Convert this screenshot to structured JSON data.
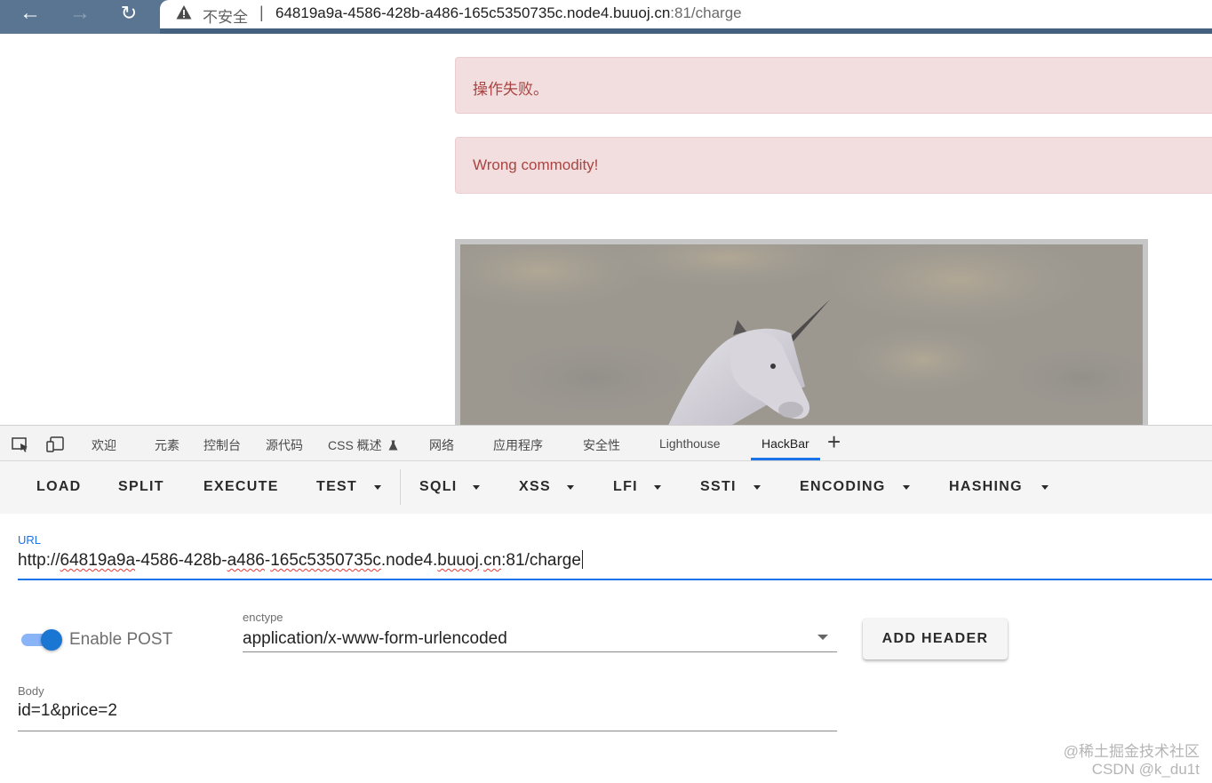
{
  "browser": {
    "nav": {
      "back": "←",
      "forward": "→",
      "reload": "↻"
    },
    "address": {
      "security_label": "不安全",
      "separator": "|",
      "url_host": "64819a9a-4586-428b-a486-165c5350735c.node4.buuoj.cn",
      "url_rest": ":81/charge"
    }
  },
  "page": {
    "alerts": [
      {
        "text": "操作失败。"
      },
      {
        "text": "Wrong commodity!"
      }
    ]
  },
  "devtools": {
    "tabs": [
      {
        "label": "欢迎"
      },
      {
        "label": "元素"
      },
      {
        "label": "控制台"
      },
      {
        "label": "源代码"
      },
      {
        "label": "CSS 概述"
      },
      {
        "label": "网络"
      },
      {
        "label": "应用程序"
      },
      {
        "label": "安全性"
      },
      {
        "label": "Lighthouse"
      },
      {
        "label": "HackBar"
      }
    ],
    "add_tab": "+"
  },
  "hackbar": {
    "toolbar": [
      "LOAD",
      "SPLIT",
      "EXECUTE",
      "TEST",
      "SQLI",
      "XSS",
      "LFI",
      "SSTI",
      "ENCODING",
      "HASHING"
    ],
    "url": {
      "label": "URL",
      "scheme": "http://",
      "parts": [
        "64819a9a",
        "-4586-428b-",
        "a486",
        "-",
        "165c5350735c",
        ".node4.",
        "buuoj",
        ".",
        "cn",
        ":81/charge"
      ]
    },
    "post": {
      "label": "Enable POST",
      "enabled": true
    },
    "enctype": {
      "label": "enctype",
      "value": "application/x-www-form-urlencoded"
    },
    "add_header": "ADD HEADER",
    "body": {
      "label": "Body",
      "value": "id=1&price=2"
    }
  },
  "watermark": {
    "line1": "@稀土掘金技术社区",
    "line2": "CSDN @k_du1t"
  },
  "colors": {
    "accent": "#1a73e8",
    "alert_bg": "#f2dede",
    "alert_text": "#a94442",
    "toggle": "#1976d2"
  }
}
